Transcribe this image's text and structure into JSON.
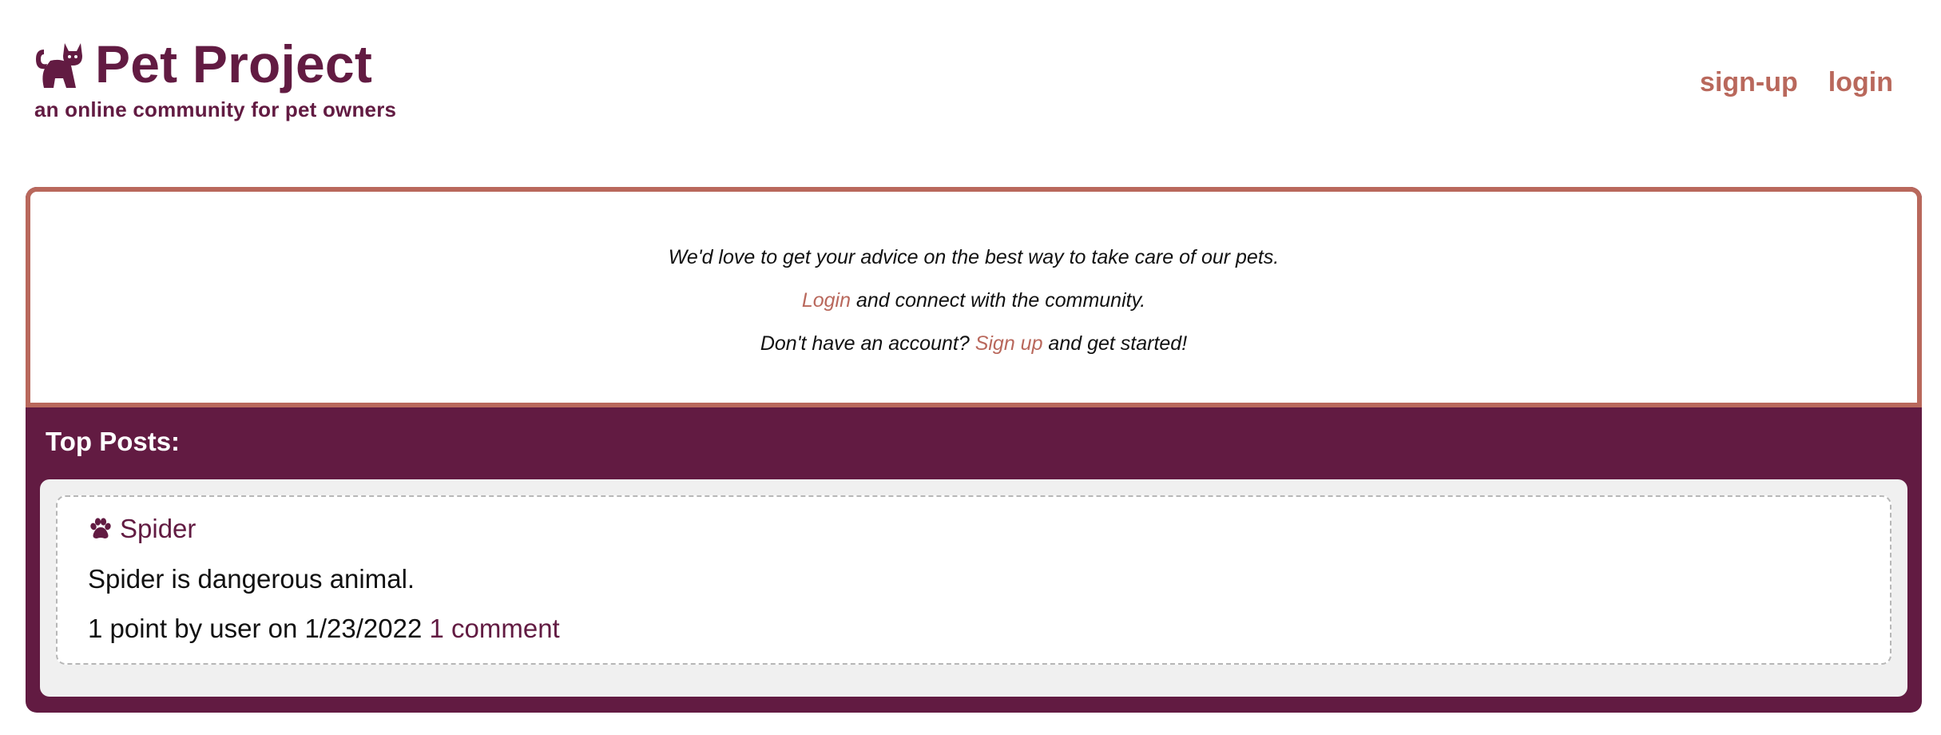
{
  "header": {
    "title": "Pet Project",
    "tagline": "an online community for pet owners",
    "logo_icon": "cat-icon"
  },
  "nav": {
    "signup_label": "sign-up",
    "login_label": "login"
  },
  "welcome": {
    "line1": "We'd love to get your advice on the best way to take care of our pets.",
    "line2_link": "Login",
    "line2_rest": " and connect with the community.",
    "line3_prefix": "Don't have an account? ",
    "line3_link": "Sign up",
    "line3_rest": " and get started!"
  },
  "top_posts": {
    "heading": "Top Posts:",
    "posts": [
      {
        "icon": "paw-icon",
        "title": "Spider",
        "body": "Spider is dangerous animal.",
        "meta": "1 point by user on 1/23/2022 ",
        "comments": "1 comment"
      }
    ]
  },
  "colors": {
    "brand": "#621b42",
    "accent": "#b9685c",
    "panel": "#f0f0f0"
  }
}
